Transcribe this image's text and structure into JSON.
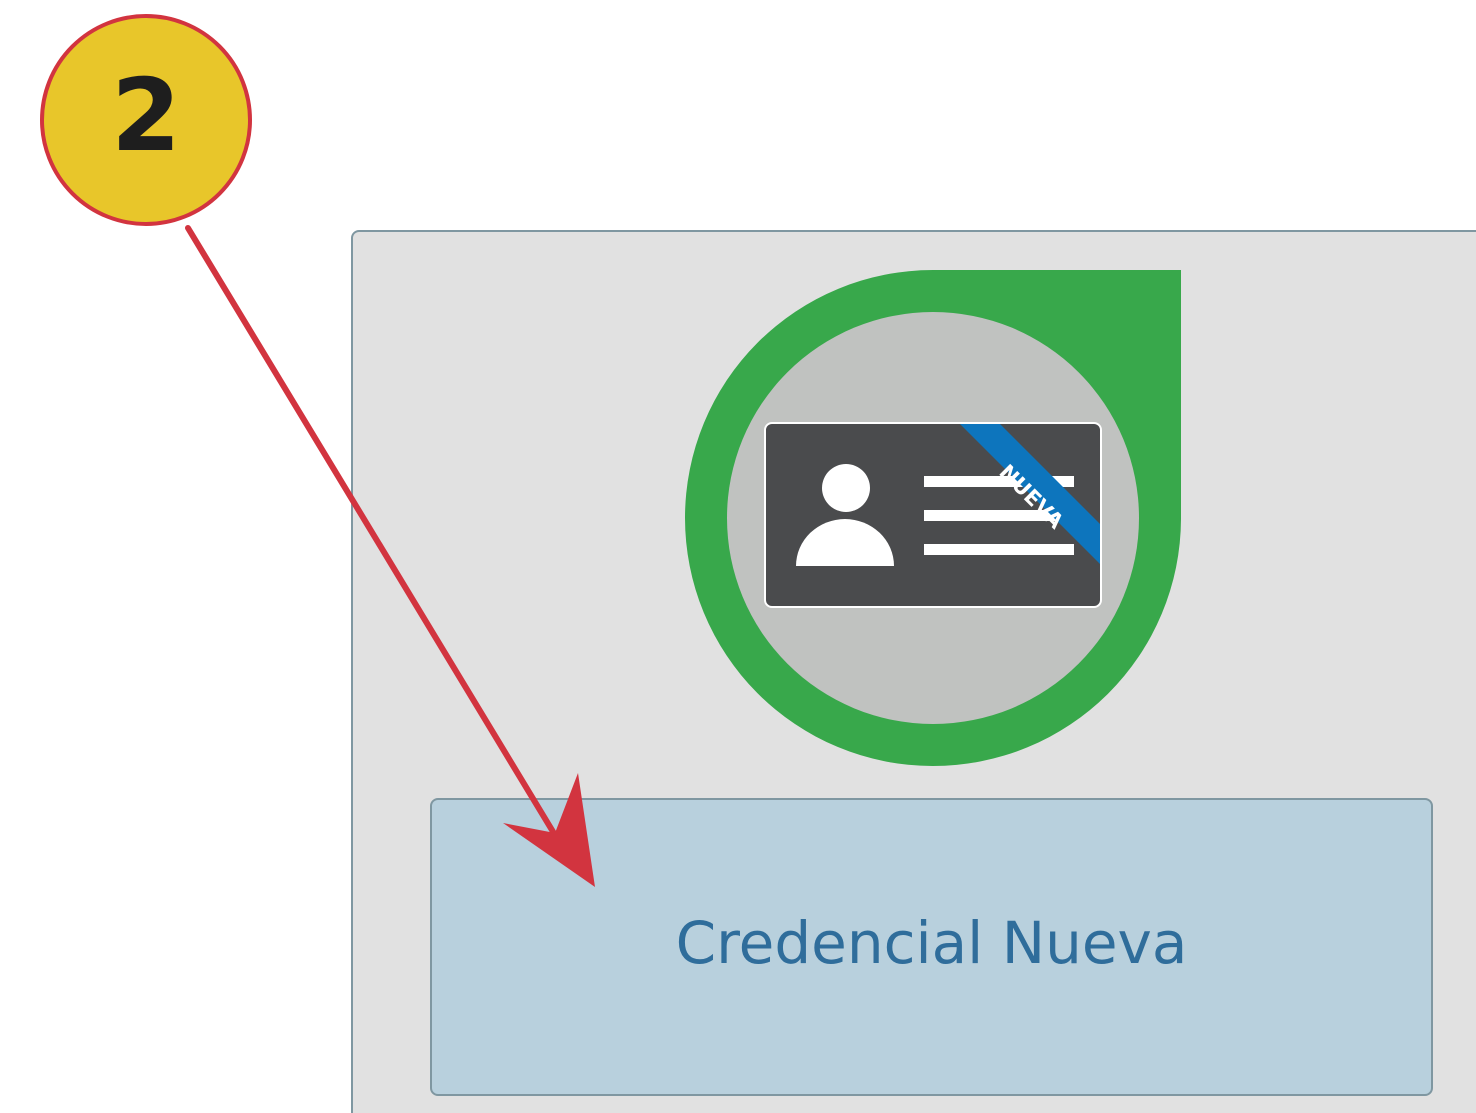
{
  "step": {
    "number": "2"
  },
  "card_icon": {
    "ribbon_text": "NUEVA",
    "ring_color": "#38a84b",
    "ribbon_color": "#0d75bd",
    "card_color": "#4a4b4d",
    "icon": "new-credential-card-icon"
  },
  "action": {
    "label": "Credencial Nueva"
  },
  "colors": {
    "badge_fill": "#e8c62a",
    "badge_border": "#d2343f",
    "arrow": "#d2343f",
    "panel_bg": "#e1e1e1",
    "button_bg": "#b8d0dd",
    "button_text": "#2f6d9b"
  }
}
